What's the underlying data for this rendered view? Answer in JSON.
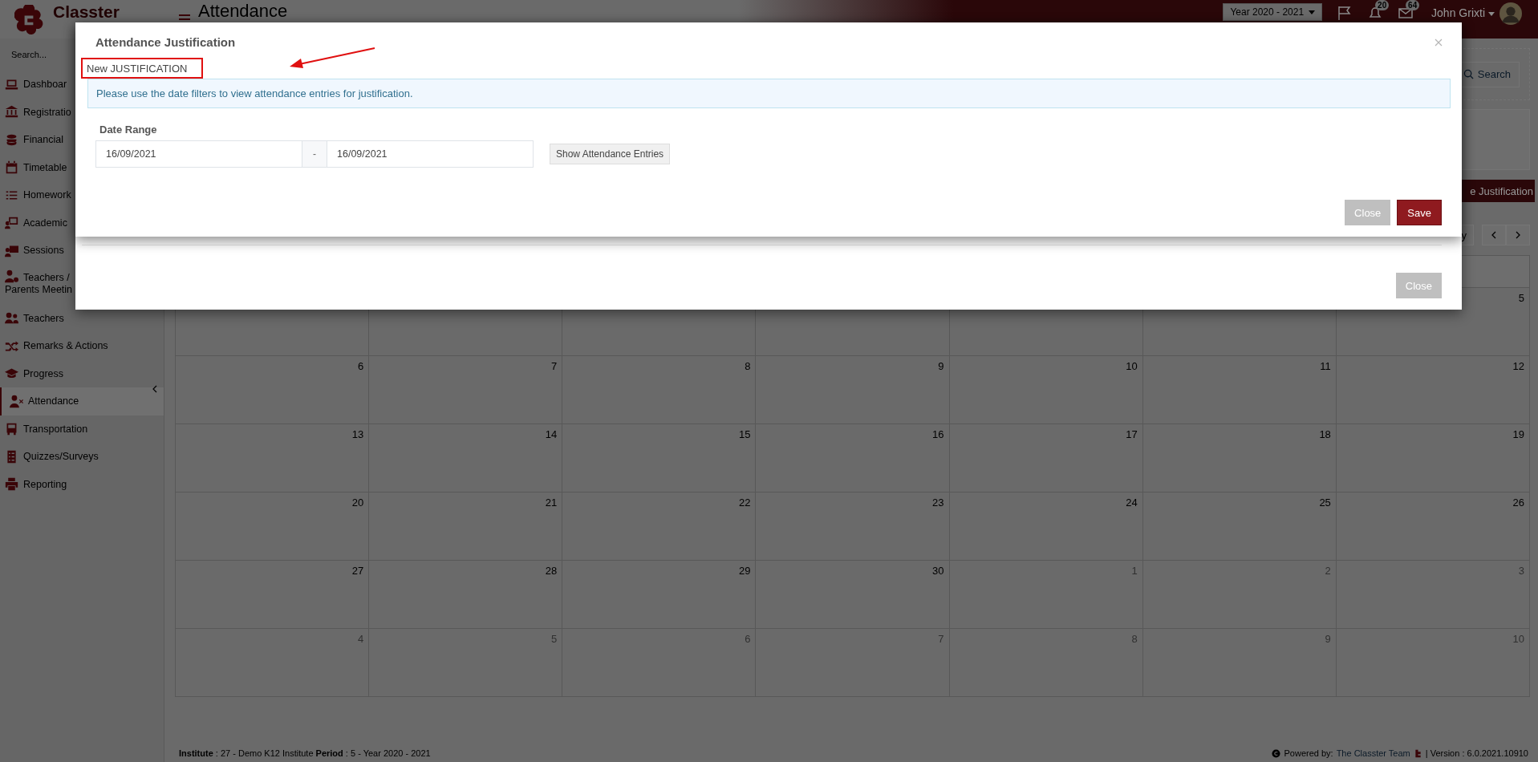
{
  "app": {
    "logo_text": "Classter",
    "page_title": "Attendance",
    "search_placeholder": "Search..."
  },
  "header": {
    "year": "Year 2020 - 2021",
    "notifications": "20",
    "messages": "64",
    "user": "John Grixti"
  },
  "sidebar": {
    "items": [
      {
        "label": "Dashboar",
        "kind": "single",
        "selected": false
      },
      {
        "label": "Registratio",
        "kind": "single",
        "selected": false
      },
      {
        "label": "Financial",
        "kind": "single",
        "selected": false
      },
      {
        "label": "Timetable",
        "kind": "single",
        "selected": false
      },
      {
        "label": "Homework",
        "kind": "single",
        "selected": false
      },
      {
        "label": "Academic",
        "kind": "single",
        "selected": false
      },
      {
        "label": "Sessions",
        "kind": "single",
        "selected": false
      },
      {
        "label": "Teachers / Parents Meetin",
        "kind": "multiline",
        "selected": false
      },
      {
        "label": "Teachers",
        "kind": "single",
        "selected": false
      },
      {
        "label": "Remarks & Actions",
        "kind": "single",
        "selected": false
      },
      {
        "label": "Progress",
        "kind": "single",
        "selected": false
      },
      {
        "label": "Attendance",
        "kind": "single",
        "selected": true
      },
      {
        "label": "Transportation",
        "kind": "single",
        "selected": false
      },
      {
        "label": "Quizzes/Surveys",
        "kind": "single",
        "selected": false
      },
      {
        "label": "Reporting",
        "kind": "single",
        "selected": false
      }
    ]
  },
  "toolbar": {
    "search_button": "Search",
    "add_button": "e Justification",
    "today_button": "y"
  },
  "calendar": {
    "weeks": [
      [
        {
          "day": "5",
          "other_month": false
        }
      ],
      [
        {
          "day": "6",
          "other_month": false
        },
        {
          "day": "7",
          "other_month": false
        },
        {
          "day": "8",
          "other_month": false
        },
        {
          "day": "9",
          "other_month": false
        },
        {
          "day": "10",
          "other_month": false
        },
        {
          "day": "11",
          "other_month": false
        },
        {
          "day": "12",
          "other_month": false
        }
      ],
      [
        {
          "day": "13",
          "other_month": false
        },
        {
          "day": "14",
          "other_month": false
        },
        {
          "day": "15",
          "other_month": false
        },
        {
          "day": "16",
          "other_month": false
        },
        {
          "day": "17",
          "other_month": false
        },
        {
          "day": "18",
          "other_month": false
        },
        {
          "day": "19",
          "other_month": false
        }
      ],
      [
        {
          "day": "20",
          "other_month": false
        },
        {
          "day": "21",
          "other_month": false
        },
        {
          "day": "22",
          "other_month": false
        },
        {
          "day": "23",
          "other_month": false
        },
        {
          "day": "24",
          "other_month": false
        },
        {
          "day": "25",
          "other_month": false
        },
        {
          "day": "26",
          "other_month": false
        }
      ],
      [
        {
          "day": "27",
          "other_month": false
        },
        {
          "day": "28",
          "other_month": false
        },
        {
          "day": "29",
          "other_month": false
        },
        {
          "day": "30",
          "other_month": false
        },
        {
          "day": "1",
          "other_month": true
        },
        {
          "day": "2",
          "other_month": true
        },
        {
          "day": "3",
          "other_month": true
        }
      ],
      [
        {
          "day": "4",
          "other_month": true
        },
        {
          "day": "5",
          "other_month": true
        },
        {
          "day": "6",
          "other_month": true
        },
        {
          "day": "7",
          "other_month": true
        },
        {
          "day": "8",
          "other_month": true
        },
        {
          "day": "9",
          "other_month": true
        },
        {
          "day": "10",
          "other_month": true
        }
      ]
    ]
  },
  "footer": {
    "info": "**Institute** : 27 - Demo K12 Institute **Period** : 5 - Year 2020 - 2021",
    "powered_by": "Powered by:",
    "team_link": "The Classter Team",
    "version": "| Version : 6.0.2021.10910"
  },
  "back_dialog": {
    "close": "Close"
  },
  "dialog": {
    "title": "Attendance Justification",
    "annotation": "New JUSTIFICATION",
    "info": "Please use the date filters to view attendance entries for justification.",
    "date_range_label": "Date Range",
    "date_from": "16/09/2021",
    "separator": "-",
    "date_to": "16/09/2021",
    "show_button": "Show Attendance Entries",
    "close": "Close",
    "save": "Save"
  }
}
